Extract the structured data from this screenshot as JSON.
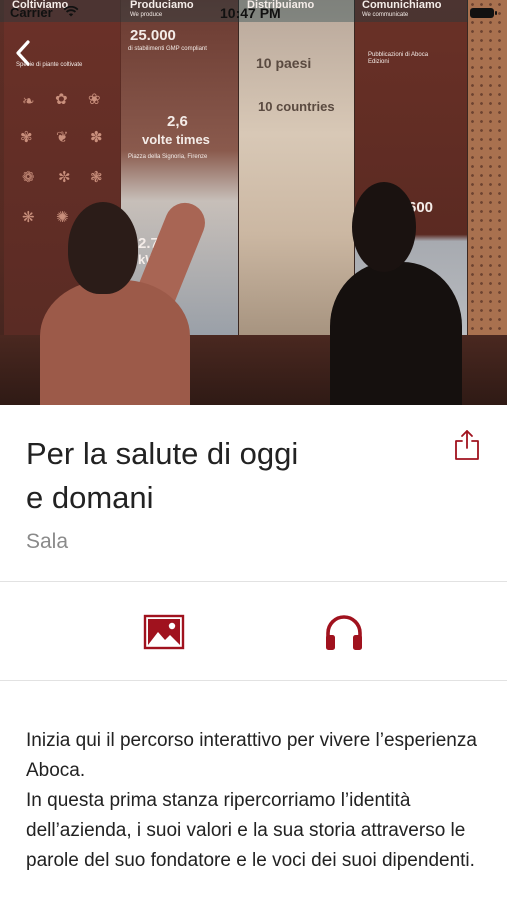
{
  "status_bar": {
    "carrier": "Carrier",
    "time": "10:47 PM"
  },
  "hero": {
    "panel_headers": [
      "Coltiviamo",
      "Produciamo",
      "Distribuiamo",
      "Comunichiamo"
    ],
    "panel_subheaders": [
      "",
      "We produce",
      "",
      "We communicate"
    ],
    "panel_texts": {
      "species": "Specie di piante coltivate",
      "plants_count": "25.000",
      "plants_caption": "di stabilimenti GMP compliant",
      "times_value": "2,6",
      "times_label": "volte times",
      "location": "Piazza della Signoria, Firenze",
      "kwh": "2.700",
      "kwh_unit": "kWh",
      "countries_10a": "10 paesi",
      "countries_10b": "10 countries",
      "publications": "Pubblicazioni di Aboca Edizioni",
      "six_hundred": "600"
    }
  },
  "detail": {
    "title": "Per la salute di oggi\ne domani",
    "subtitle": "Sala"
  },
  "media_buttons": {
    "image_icon": "image-icon",
    "audio_icon": "headphones-icon"
  },
  "colors": {
    "accent": "#a0121e",
    "divider": "#e2e2e2",
    "subtitle": "#8a8a8a"
  },
  "description": [
    "Inizia qui il percorso interattivo per vivere l’esperienza Aboca.",
    "In questa prima stanza ripercorriamo l’identità dell’azienda, i suoi valori e la sua storia attraverso le parole del suo fondatore e le voci dei suoi dipendenti."
  ]
}
